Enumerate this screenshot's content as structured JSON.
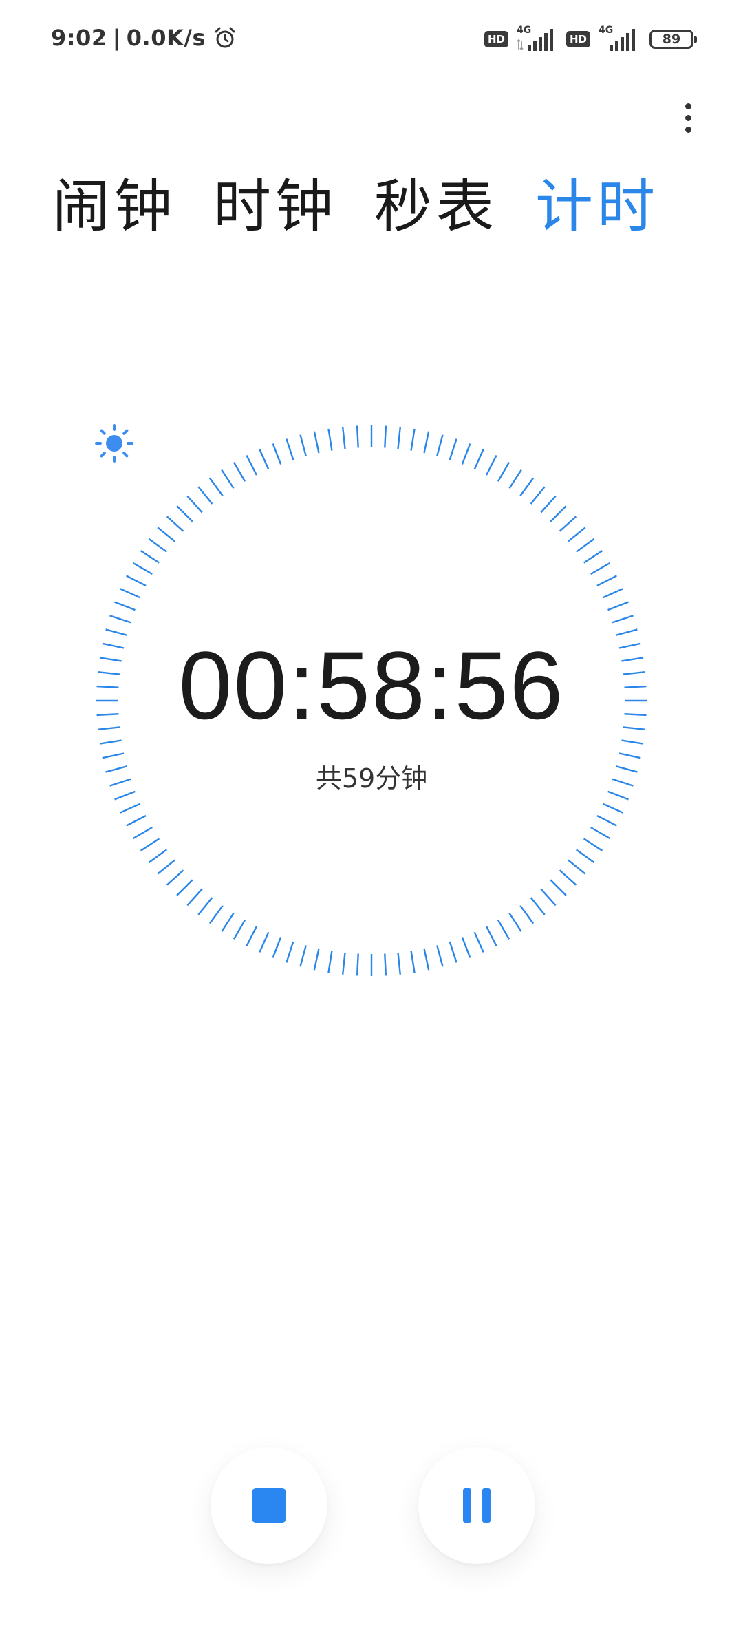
{
  "status_bar": {
    "time": "9:02",
    "separator": "|",
    "network_speed": "0.0K/s",
    "alarm_icon": "alarm-clock-icon",
    "sim1_badge": "HD",
    "sim1_network": "4G",
    "sim2_badge": "HD",
    "sim2_network": "4G",
    "battery_level": "89"
  },
  "header": {
    "menu_icon": "more-vertical-icon"
  },
  "tabs": [
    {
      "label": "闹钟",
      "active": false
    },
    {
      "label": "时钟",
      "active": false
    },
    {
      "label": "秒表",
      "active": false
    },
    {
      "label": "计时",
      "active": true
    }
  ],
  "timer": {
    "remaining": "00:58:56",
    "total_label": "共59分钟",
    "light_icon": "sun-icon",
    "tick_count": 120
  },
  "controls": {
    "stop_icon": "stop-icon",
    "pause_icon": "pause-icon"
  },
  "colors": {
    "accent": "#2a86e8",
    "button_accent": "#2a86f0",
    "text": "#1a1a1a"
  }
}
